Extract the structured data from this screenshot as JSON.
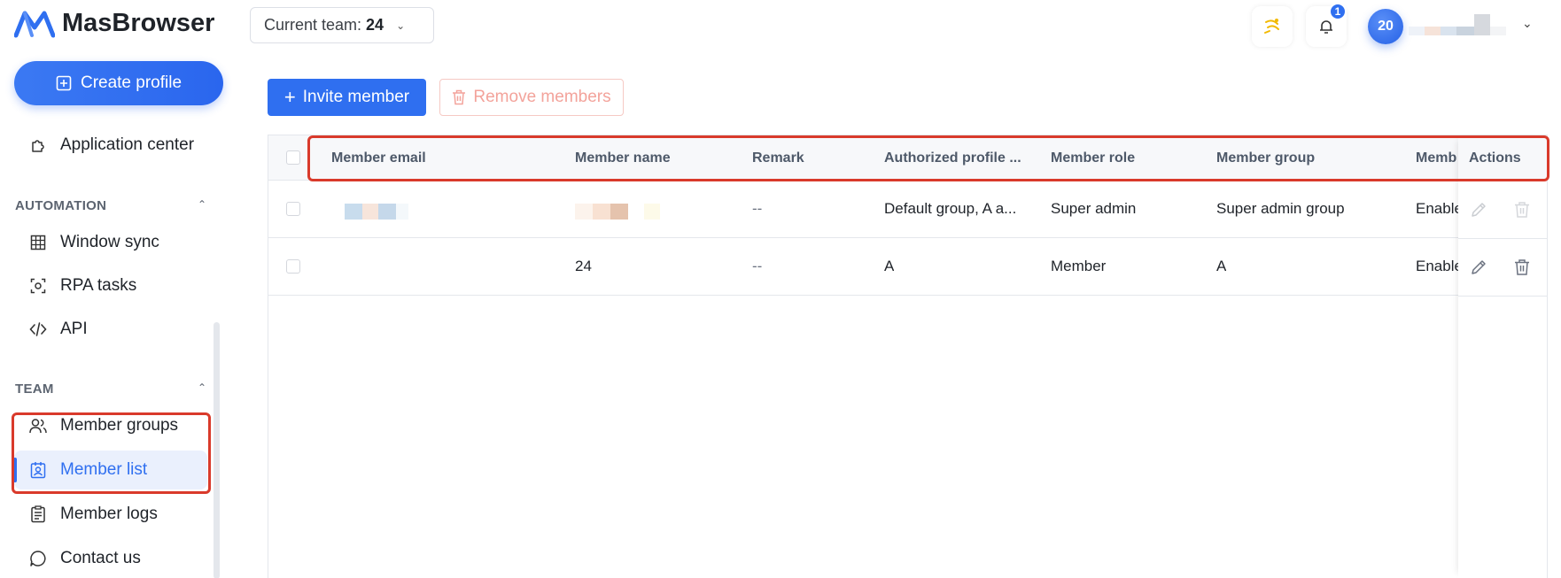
{
  "app": {
    "name": "MasBrowser"
  },
  "header": {
    "team_label": "Current team:",
    "team_value": "24",
    "notification_count": "1",
    "avatar_text": "20"
  },
  "sidebar": {
    "create_profile": "Create profile",
    "application_center": "Application center",
    "section_automation": "AUTOMATION",
    "automation_items": [
      "Window sync",
      "RPA tasks",
      "API"
    ],
    "section_team": "TEAM",
    "team_items": [
      "Member groups",
      "Member list",
      "Member logs",
      "Contact us"
    ],
    "active_item": "Member list"
  },
  "toolbar": {
    "invite_label": "Invite member",
    "remove_label": "Remove members"
  },
  "table": {
    "columns": [
      "Member email",
      "Member name",
      "Remark",
      "Authorized profile ...",
      "Member role",
      "Member group",
      "Memb",
      "Actions"
    ],
    "rows": [
      {
        "email": "",
        "name": "",
        "remark": "--",
        "authorized": "Default group, A a...",
        "role": "Super admin",
        "group": "Super admin group",
        "status": "Enable"
      },
      {
        "email": "",
        "name": "24",
        "remark": "--",
        "authorized": "A",
        "role": "Member",
        "group": "A",
        "status": "Enable"
      }
    ]
  },
  "colors": {
    "accent": "#2f6ff0",
    "highlight": "#d93a2b",
    "danger_light": "#f3a39b"
  }
}
